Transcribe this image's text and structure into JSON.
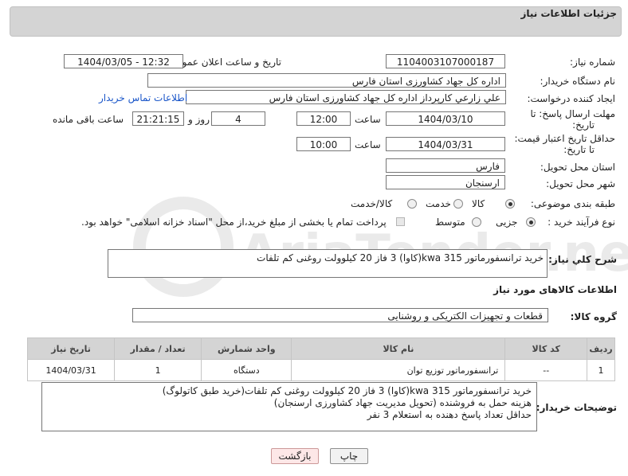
{
  "header": {
    "title": "جزئیات اطلاعات نیاز"
  },
  "form": {
    "need_number_label": "شماره نیاز:",
    "need_number": "1104003107000187",
    "announce_label": "تاریخ و ساعت اعلان عمومی:",
    "announce_value": "1404/03/05 - 12:32",
    "buyer_org_label": "نام دستگاه خریدار:",
    "buyer_org": "اداره کل جهاد کشاورزی استان فارس",
    "creator_label": "ایجاد کننده درخواست:",
    "creator": "علي زارعي کارپرداز اداره کل جهاد کشاورزی استان فارس",
    "contact_link": "اطلاعات تماس خریدار",
    "deadline_label_1": "مهلت ارسال پاسخ: تا",
    "deadline_label_2": "تاریخ:",
    "deadline_date": "1404/03/10",
    "time_label": "ساعت",
    "deadline_time": "12:00",
    "days_value": "4",
    "days_label": "روز و",
    "remaining_time": "21:21:15",
    "remaining_label": "ساعت باقی مانده",
    "validity_label_1": "حداقل تاریخ اعتبار قیمت:",
    "validity_label_2": "تا تاریخ:",
    "validity_date": "1404/03/31",
    "validity_time": "10:00",
    "province_label": "استان محل تحویل:",
    "province": "فارس",
    "city_label": "شهر محل تحویل:",
    "city": "ارسنجان",
    "category_label": "طبقه بندی موضوعی:",
    "category_options": [
      "کالا",
      "خدمت",
      "کالا/خدمت"
    ],
    "process_label": "نوع فرآیند خرید :",
    "process_options": [
      "جزیی",
      "متوسط"
    ],
    "payment_note": "پرداخت تمام یا بخشی از مبلغ خرید،از محل \"اسناد خزانه اسلامی\" خواهد بود."
  },
  "description": {
    "label": "شرح کلي نياز:",
    "text": "خرید ترانسفورماتور kwa 315(کاوا) 3 فاز 20 کیلوولت روغنی کم تلفات"
  },
  "goods": {
    "section_title": "اطلاعات کالاهای مورد نیاز",
    "group_label": "گروه کالا:",
    "group_value": "قطعات و تجهیزات الکتریکی و روشنایی",
    "table": {
      "headers": [
        "ردیف",
        "کد کالا",
        "نام کالا",
        "واحد شمارش",
        "تعداد / مقدار",
        "تاریخ نیاز"
      ],
      "rows": [
        [
          "1",
          "--",
          "ترانسفورماتور توزیع توان",
          "دستگاه",
          "1",
          "1404/03/31"
        ]
      ]
    }
  },
  "buyer_notes": {
    "label": "توضیحات خریدار:",
    "lines": [
      "خرید ترانسفورماتور kwa 315(کاوا) 3 فاز 20 کیلوولت روغنی کم تلفات(خرید طبق کاتولوگ)",
      "هزینه حمل به فروشنده (تحویل مدیریت جهاد کشاورزی ارسنجان)",
      "حداقل تعداد پاسخ دهنده به استعلام 3 نفر"
    ]
  },
  "buttons": {
    "print": "چاپ",
    "back": "بازگشت"
  },
  "watermark": "AriaTender.neT"
}
